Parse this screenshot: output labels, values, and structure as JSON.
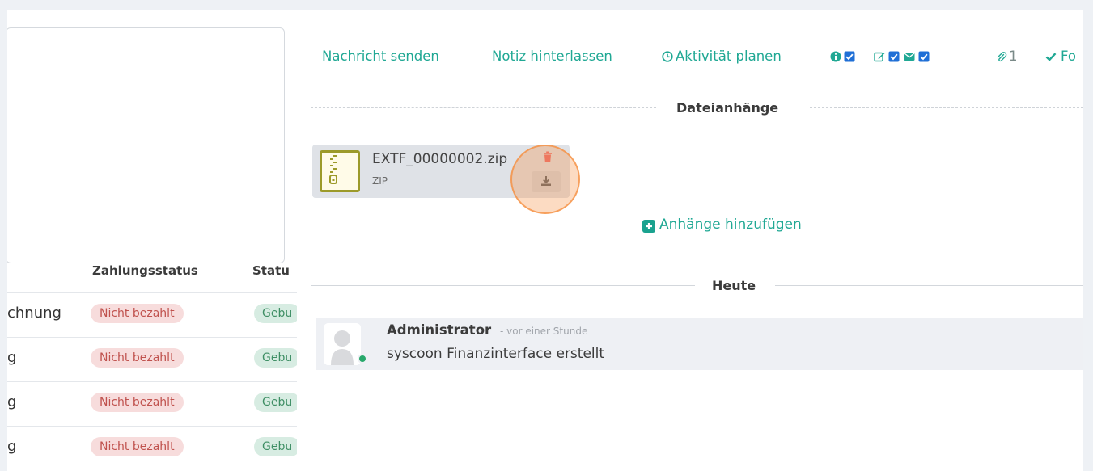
{
  "left_list": {
    "columns": {
      "payment_status": "Zahlungsstatus",
      "status": "Statu"
    },
    "rows": [
      {
        "name": "chnung",
        "payment_status": "Nicht bezahlt",
        "status": "Gebu"
      },
      {
        "name": "g",
        "payment_status": "Nicht bezahlt",
        "status": "Gebu"
      },
      {
        "name": "g",
        "payment_status": "Nicht bezahlt",
        "status": "Gebu"
      },
      {
        "name": "g",
        "payment_status": "Nicht bezahlt",
        "status": "Gebu"
      }
    ]
  },
  "chatter": {
    "toolbar": {
      "send_message": "Nachricht senden",
      "log_note": "Notiz hinterlassen",
      "schedule_activity": "Aktivität planen",
      "attachment_count": "1",
      "follow": "Fo"
    },
    "attachments_section": {
      "title": "Dateianhänge",
      "file": {
        "name": "EXTF_00000002.zip",
        "type": "ZIP"
      },
      "add_label": "Anhänge hinzufügen"
    },
    "date_separator": "Heute",
    "message": {
      "author": "Administrator",
      "time": "- vor einer Stunde",
      "body": "syscoon Finanzinterface erstellt"
    }
  },
  "colors": {
    "accent": "#20a894",
    "icon_blue": "#1f6fd6",
    "unpaid_bg": "#f7dcdc",
    "unpaid_text": "#c0524e",
    "booked_bg": "#d7ece2",
    "booked_text": "#3f8f65",
    "focus_ring": "#f68c3c"
  },
  "icons": [
    "info-icon",
    "edit-icon",
    "envelope-icon",
    "checkbox-icon",
    "paperclip-icon",
    "check-icon",
    "clock-icon",
    "zip-file-icon",
    "trash-icon",
    "download-icon",
    "plus-square-icon",
    "user-avatar"
  ]
}
